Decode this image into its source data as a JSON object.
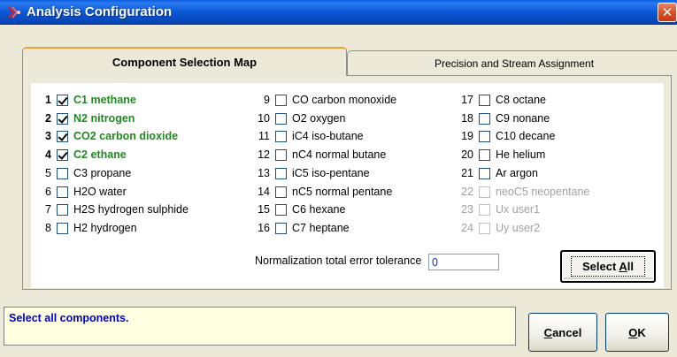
{
  "window": {
    "title": "Analysis Configuration",
    "close_label": "✕"
  },
  "tabs": [
    {
      "label": "Component Selection Map",
      "active": true
    },
    {
      "label": "Precision and Stream Assignment",
      "active": false
    }
  ],
  "components": [
    {
      "num": "1",
      "label": "C1 methane",
      "checked": true,
      "enabled": true
    },
    {
      "num": "2",
      "label": "N2 nitrogen",
      "checked": true,
      "enabled": true
    },
    {
      "num": "3",
      "label": "CO2 carbon dioxide",
      "checked": true,
      "enabled": true
    },
    {
      "num": "4",
      "label": "C2 ethane",
      "checked": true,
      "enabled": true
    },
    {
      "num": "5",
      "label": "C3 propane",
      "checked": false,
      "enabled": true
    },
    {
      "num": "6",
      "label": "H2O water",
      "checked": false,
      "enabled": true
    },
    {
      "num": "7",
      "label": "H2S hydrogen sulphide",
      "checked": false,
      "enabled": true
    },
    {
      "num": "8",
      "label": "H2 hydrogen",
      "checked": false,
      "enabled": true
    },
    {
      "num": "9",
      "label": "CO carbon monoxide",
      "checked": false,
      "enabled": true
    },
    {
      "num": "10",
      "label": "O2 oxygen",
      "checked": false,
      "enabled": true
    },
    {
      "num": "11",
      "label": "iC4 iso-butane",
      "checked": false,
      "enabled": true
    },
    {
      "num": "12",
      "label": "nC4 normal butane",
      "checked": false,
      "enabled": true
    },
    {
      "num": "13",
      "label": "iC5 iso-pentane",
      "checked": false,
      "enabled": true
    },
    {
      "num": "14",
      "label": "nC5 normal pentane",
      "checked": false,
      "enabled": true
    },
    {
      "num": "15",
      "label": "C6 hexane",
      "checked": false,
      "enabled": true
    },
    {
      "num": "16",
      "label": "C7 heptane",
      "checked": false,
      "enabled": true
    },
    {
      "num": "17",
      "label": "C8 octane",
      "checked": false,
      "enabled": true
    },
    {
      "num": "18",
      "label": "C9 nonane",
      "checked": false,
      "enabled": true
    },
    {
      "num": "19",
      "label": "C10 decane",
      "checked": false,
      "enabled": true
    },
    {
      "num": "20",
      "label": "He helium",
      "checked": false,
      "enabled": true
    },
    {
      "num": "21",
      "label": "Ar argon",
      "checked": false,
      "enabled": true
    },
    {
      "num": "22",
      "label": "neoC5 neopentane",
      "checked": false,
      "enabled": false
    },
    {
      "num": "23",
      "label": "Ux user1",
      "checked": false,
      "enabled": false
    },
    {
      "num": "24",
      "label": "Uy user2",
      "checked": false,
      "enabled": false
    }
  ],
  "tolerance": {
    "label": "Normalization total error tolerance",
    "value": "0"
  },
  "buttons": {
    "select_all": "Select All",
    "cancel": "Cancel",
    "ok": "OK"
  },
  "status": {
    "message": "Select all components."
  },
  "colors": {
    "selected_label": "#1f8a1f",
    "status_text": "#0000cc",
    "status_bg": "#ffffe1"
  }
}
